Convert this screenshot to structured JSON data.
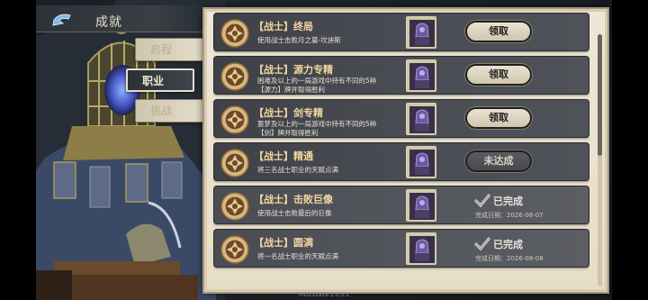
{
  "header": {
    "title": "成就",
    "back_icon": "back-arrow-icon"
  },
  "side_tabs": [
    {
      "label": "启程",
      "active": false
    },
    {
      "label": "职业",
      "active": true
    },
    {
      "label": "挑战",
      "active": false
    }
  ],
  "class_icons": [
    "warrior-class-icon",
    "class-emblem-icon",
    "class-emblem-icon"
  ],
  "achievements": [
    {
      "title": "【战士】终局",
      "desc": [
        "使用战士击败月之墓-坎迪斯"
      ],
      "state": "claim",
      "button": "领取"
    },
    {
      "title": "【战士】源力专精",
      "desc": [
        "困难及以上的一局游戏中持有不同的5种",
        "【源力】牌并取得胜利"
      ],
      "state": "claim",
      "button": "领取"
    },
    {
      "title": "【战士】剑专精",
      "desc": [
        "噩梦及以上的一局游戏中持有不同的5种",
        "【剑】牌并取得胜利"
      ],
      "state": "claim",
      "button": "领取"
    },
    {
      "title": "【战士】精通",
      "desc": [
        "将三名战士职业的天赋点满"
      ],
      "state": "locked",
      "button": "未达成"
    },
    {
      "title": "【战士】击败巨像",
      "desc": [
        "使用战士击败最后的巨像"
      ],
      "state": "done",
      "done_label": "已完成",
      "date": "完成日期：2026-08-07"
    },
    {
      "title": "【战士】圆满",
      "desc": [
        "将一名战士职业的天赋点满"
      ],
      "state": "done",
      "done_label": "已完成",
      "date": "完成日期：2026-08-08"
    }
  ],
  "scroll": {
    "fraction": 0.48
  },
  "build": "PID232928  1.0.5.1",
  "colors": {
    "title_gold": "#f1d79c",
    "row_dark": "#45474e",
    "panel_paper": "#eae2cf"
  }
}
